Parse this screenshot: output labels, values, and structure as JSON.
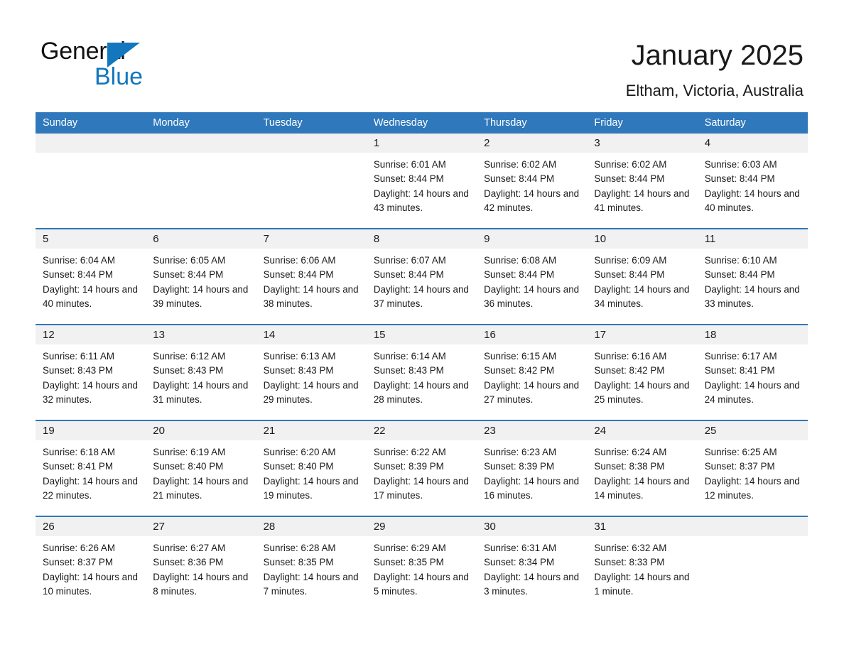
{
  "brand": {
    "name_part1": "General",
    "name_part2": "Blue",
    "accent_color": "#1277bd"
  },
  "header": {
    "title": "January 2025",
    "subtitle": "Eltham, Victoria, Australia"
  },
  "theme": {
    "header_blue": "#2f78bc",
    "row_divider_blue": "#2f78bc",
    "date_band_gray": "#f1f1f1",
    "text_color": "#1a1a1a"
  },
  "weekday_headers": [
    "Sunday",
    "Monday",
    "Tuesday",
    "Wednesday",
    "Thursday",
    "Friday",
    "Saturday"
  ],
  "weeks": [
    [
      {
        "date": "",
        "sunrise": "",
        "sunset": "",
        "daylight": "",
        "empty": true
      },
      {
        "date": "",
        "sunrise": "",
        "sunset": "",
        "daylight": "",
        "empty": true
      },
      {
        "date": "",
        "sunrise": "",
        "sunset": "",
        "daylight": "",
        "empty": true
      },
      {
        "date": "1",
        "sunrise": "Sunrise: 6:01 AM",
        "sunset": "Sunset: 8:44 PM",
        "daylight": "Daylight: 14 hours and 43 minutes."
      },
      {
        "date": "2",
        "sunrise": "Sunrise: 6:02 AM",
        "sunset": "Sunset: 8:44 PM",
        "daylight": "Daylight: 14 hours and 42 minutes."
      },
      {
        "date": "3",
        "sunrise": "Sunrise: 6:02 AM",
        "sunset": "Sunset: 8:44 PM",
        "daylight": "Daylight: 14 hours and 41 minutes."
      },
      {
        "date": "4",
        "sunrise": "Sunrise: 6:03 AM",
        "sunset": "Sunset: 8:44 PM",
        "daylight": "Daylight: 14 hours and 40 minutes."
      }
    ],
    [
      {
        "date": "5",
        "sunrise": "Sunrise: 6:04 AM",
        "sunset": "Sunset: 8:44 PM",
        "daylight": "Daylight: 14 hours and 40 minutes."
      },
      {
        "date": "6",
        "sunrise": "Sunrise: 6:05 AM",
        "sunset": "Sunset: 8:44 PM",
        "daylight": "Daylight: 14 hours and 39 minutes."
      },
      {
        "date": "7",
        "sunrise": "Sunrise: 6:06 AM",
        "sunset": "Sunset: 8:44 PM",
        "daylight": "Daylight: 14 hours and 38 minutes."
      },
      {
        "date": "8",
        "sunrise": "Sunrise: 6:07 AM",
        "sunset": "Sunset: 8:44 PM",
        "daylight": "Daylight: 14 hours and 37 minutes."
      },
      {
        "date": "9",
        "sunrise": "Sunrise: 6:08 AM",
        "sunset": "Sunset: 8:44 PM",
        "daylight": "Daylight: 14 hours and 36 minutes."
      },
      {
        "date": "10",
        "sunrise": "Sunrise: 6:09 AM",
        "sunset": "Sunset: 8:44 PM",
        "daylight": "Daylight: 14 hours and 34 minutes."
      },
      {
        "date": "11",
        "sunrise": "Sunrise: 6:10 AM",
        "sunset": "Sunset: 8:44 PM",
        "daylight": "Daylight: 14 hours and 33 minutes."
      }
    ],
    [
      {
        "date": "12",
        "sunrise": "Sunrise: 6:11 AM",
        "sunset": "Sunset: 8:43 PM",
        "daylight": "Daylight: 14 hours and 32 minutes."
      },
      {
        "date": "13",
        "sunrise": "Sunrise: 6:12 AM",
        "sunset": "Sunset: 8:43 PM",
        "daylight": "Daylight: 14 hours and 31 minutes."
      },
      {
        "date": "14",
        "sunrise": "Sunrise: 6:13 AM",
        "sunset": "Sunset: 8:43 PM",
        "daylight": "Daylight: 14 hours and 29 minutes."
      },
      {
        "date": "15",
        "sunrise": "Sunrise: 6:14 AM",
        "sunset": "Sunset: 8:43 PM",
        "daylight": "Daylight: 14 hours and 28 minutes."
      },
      {
        "date": "16",
        "sunrise": "Sunrise: 6:15 AM",
        "sunset": "Sunset: 8:42 PM",
        "daylight": "Daylight: 14 hours and 27 minutes."
      },
      {
        "date": "17",
        "sunrise": "Sunrise: 6:16 AM",
        "sunset": "Sunset: 8:42 PM",
        "daylight": "Daylight: 14 hours and 25 minutes."
      },
      {
        "date": "18",
        "sunrise": "Sunrise: 6:17 AM",
        "sunset": "Sunset: 8:41 PM",
        "daylight": "Daylight: 14 hours and 24 minutes."
      }
    ],
    [
      {
        "date": "19",
        "sunrise": "Sunrise: 6:18 AM",
        "sunset": "Sunset: 8:41 PM",
        "daylight": "Daylight: 14 hours and 22 minutes."
      },
      {
        "date": "20",
        "sunrise": "Sunrise: 6:19 AM",
        "sunset": "Sunset: 8:40 PM",
        "daylight": "Daylight: 14 hours and 21 minutes."
      },
      {
        "date": "21",
        "sunrise": "Sunrise: 6:20 AM",
        "sunset": "Sunset: 8:40 PM",
        "daylight": "Daylight: 14 hours and 19 minutes."
      },
      {
        "date": "22",
        "sunrise": "Sunrise: 6:22 AM",
        "sunset": "Sunset: 8:39 PM",
        "daylight": "Daylight: 14 hours and 17 minutes."
      },
      {
        "date": "23",
        "sunrise": "Sunrise: 6:23 AM",
        "sunset": "Sunset: 8:39 PM",
        "daylight": "Daylight: 14 hours and 16 minutes."
      },
      {
        "date": "24",
        "sunrise": "Sunrise: 6:24 AM",
        "sunset": "Sunset: 8:38 PM",
        "daylight": "Daylight: 14 hours and 14 minutes."
      },
      {
        "date": "25",
        "sunrise": "Sunrise: 6:25 AM",
        "sunset": "Sunset: 8:37 PM",
        "daylight": "Daylight: 14 hours and 12 minutes."
      }
    ],
    [
      {
        "date": "26",
        "sunrise": "Sunrise: 6:26 AM",
        "sunset": "Sunset: 8:37 PM",
        "daylight": "Daylight: 14 hours and 10 minutes."
      },
      {
        "date": "27",
        "sunrise": "Sunrise: 6:27 AM",
        "sunset": "Sunset: 8:36 PM",
        "daylight": "Daylight: 14 hours and 8 minutes."
      },
      {
        "date": "28",
        "sunrise": "Sunrise: 6:28 AM",
        "sunset": "Sunset: 8:35 PM",
        "daylight": "Daylight: 14 hours and 7 minutes."
      },
      {
        "date": "29",
        "sunrise": "Sunrise: 6:29 AM",
        "sunset": "Sunset: 8:35 PM",
        "daylight": "Daylight: 14 hours and 5 minutes."
      },
      {
        "date": "30",
        "sunrise": "Sunrise: 6:31 AM",
        "sunset": "Sunset: 8:34 PM",
        "daylight": "Daylight: 14 hours and 3 minutes."
      },
      {
        "date": "31",
        "sunrise": "Sunrise: 6:32 AM",
        "sunset": "Sunset: 8:33 PM",
        "daylight": "Daylight: 14 hours and 1 minute."
      },
      {
        "date": "",
        "sunrise": "",
        "sunset": "",
        "daylight": "",
        "empty": true
      }
    ]
  ]
}
